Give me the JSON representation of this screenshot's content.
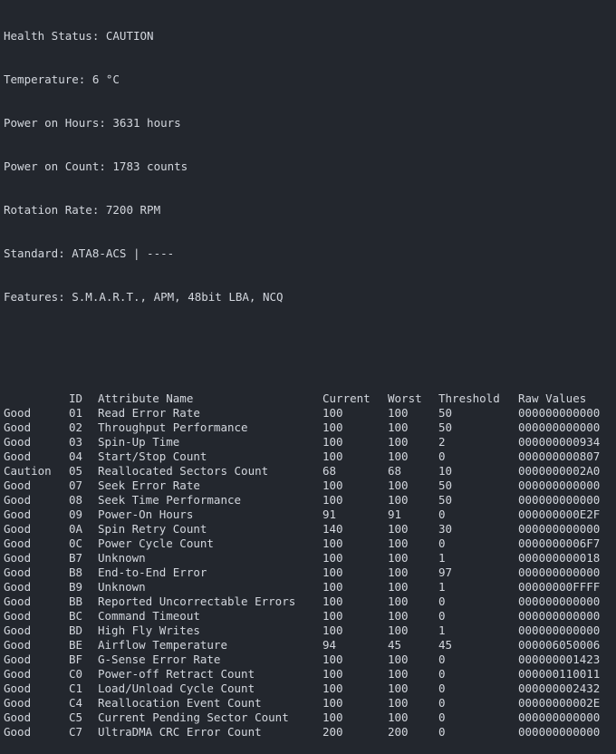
{
  "info": {
    "health": "Health Status: CAUTION",
    "temperature": "Temperature: 6 °C",
    "power_on_hours": "Power on Hours: 3631 hours",
    "power_on_count": "Power on Count: 1783 counts",
    "rotation_rate": "Rotation Rate: 7200 RPM",
    "standard": "Standard: ATA8-ACS | ----",
    "features": "Features: S.M.A.R.T., APM, 48bit LBA, NCQ"
  },
  "table": {
    "headers": {
      "status": "",
      "id": "ID",
      "name": "Attribute Name",
      "current": "Current",
      "worst": "Worst",
      "threshold": "Threshold",
      "raw": "Raw Values"
    },
    "rows": [
      {
        "status": "Good",
        "id": "01",
        "name": "Read Error Rate",
        "current": "100",
        "worst": "100",
        "threshold": "50",
        "raw": "000000000000"
      },
      {
        "status": "Good",
        "id": "02",
        "name": "Throughput Performance",
        "current": "100",
        "worst": "100",
        "threshold": "50",
        "raw": "000000000000"
      },
      {
        "status": "Good",
        "id": "03",
        "name": "Spin-Up Time",
        "current": "100",
        "worst": "100",
        "threshold": "2",
        "raw": "000000000934"
      },
      {
        "status": "Good",
        "id": "04",
        "name": "Start/Stop Count",
        "current": "100",
        "worst": "100",
        "threshold": "0",
        "raw": "000000000807"
      },
      {
        "status": "Caution",
        "id": "05",
        "name": "Reallocated Sectors Count",
        "current": "68",
        "worst": "68",
        "threshold": "10",
        "raw": "0000000002A0"
      },
      {
        "status": "Good",
        "id": "07",
        "name": "Seek Error Rate",
        "current": "100",
        "worst": "100",
        "threshold": "50",
        "raw": "000000000000"
      },
      {
        "status": "Good",
        "id": "08",
        "name": "Seek Time Performance",
        "current": "100",
        "worst": "100",
        "threshold": "50",
        "raw": "000000000000"
      },
      {
        "status": "Good",
        "id": "09",
        "name": "Power-On Hours",
        "current": "91",
        "worst": "91",
        "threshold": "0",
        "raw": "000000000E2F"
      },
      {
        "status": "Good",
        "id": "0A",
        "name": "Spin Retry Count",
        "current": "140",
        "worst": "100",
        "threshold": "30",
        "raw": "000000000000"
      },
      {
        "status": "Good",
        "id": "0C",
        "name": "Power Cycle Count",
        "current": "100",
        "worst": "100",
        "threshold": "0",
        "raw": "0000000006F7"
      },
      {
        "status": "Good",
        "id": "B7",
        "name": "Unknown",
        "current": "100",
        "worst": "100",
        "threshold": "1",
        "raw": "000000000018"
      },
      {
        "status": "Good",
        "id": "B8",
        "name": "End-to-End Error",
        "current": "100",
        "worst": "100",
        "threshold": "97",
        "raw": "000000000000"
      },
      {
        "status": "Good",
        "id": "B9",
        "name": "Unknown",
        "current": "100",
        "worst": "100",
        "threshold": "1",
        "raw": "00000000FFFF"
      },
      {
        "status": "Good",
        "id": "BB",
        "name": "Reported Uncorrectable Errors",
        "current": "100",
        "worst": "100",
        "threshold": "0",
        "raw": "000000000000"
      },
      {
        "status": "Good",
        "id": "BC",
        "name": "Command Timeout",
        "current": "100",
        "worst": "100",
        "threshold": "0",
        "raw": "000000000000"
      },
      {
        "status": "Good",
        "id": "BD",
        "name": "High Fly Writes",
        "current": "100",
        "worst": "100",
        "threshold": "1",
        "raw": "000000000000"
      },
      {
        "status": "Good",
        "id": "BE",
        "name": "Airflow Temperature",
        "current": "94",
        "worst": "45",
        "threshold": "45",
        "raw": "000006050006"
      },
      {
        "status": "Good",
        "id": "BF",
        "name": "G-Sense Error Rate",
        "current": "100",
        "worst": "100",
        "threshold": "0",
        "raw": "000000001423"
      },
      {
        "status": "Good",
        "id": "C0",
        "name": "Power-off Retract Count",
        "current": "100",
        "worst": "100",
        "threshold": "0",
        "raw": "000000110011"
      },
      {
        "status": "Good",
        "id": "C1",
        "name": "Load/Unload Cycle Count",
        "current": "100",
        "worst": "100",
        "threshold": "0",
        "raw": "000000002432"
      },
      {
        "status": "Good",
        "id": "C4",
        "name": "Reallocation Event Count",
        "current": "100",
        "worst": "100",
        "threshold": "0",
        "raw": "00000000002E"
      },
      {
        "status": "Good",
        "id": "C5",
        "name": "Current Pending Sector Count",
        "current": "100",
        "worst": "100",
        "threshold": "0",
        "raw": "000000000000"
      },
      {
        "status": "Good",
        "id": "C7",
        "name": "UltraDMA CRC Error Count",
        "current": "200",
        "worst": "200",
        "threshold": "0",
        "raw": "000000000000"
      }
    ]
  },
  "colors": {
    "background": "#23272e",
    "text": "#d3d7de"
  }
}
